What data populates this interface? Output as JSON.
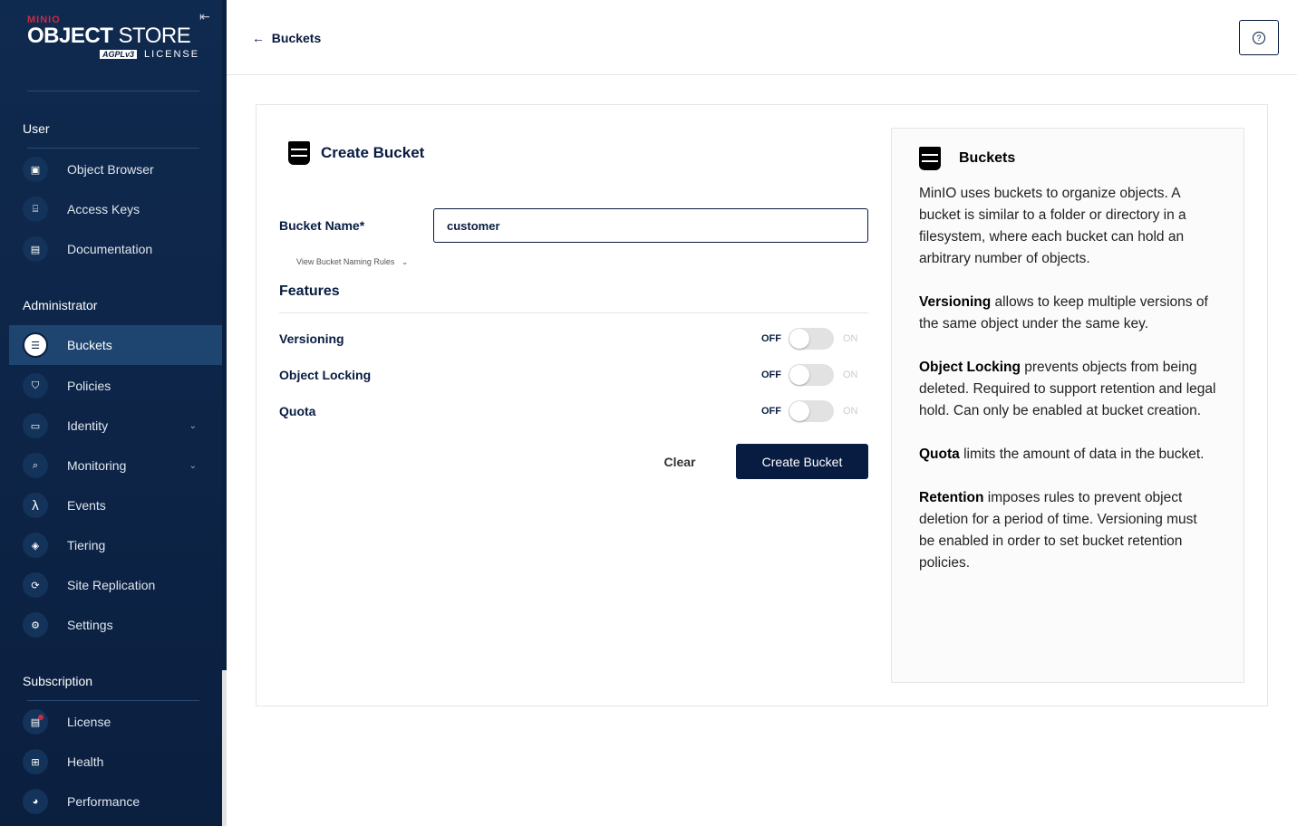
{
  "brand": {
    "minio": "MINIO",
    "object": "OBJECT",
    "store": "STORE",
    "agpl": "AGPLv3",
    "license": "LICENSE"
  },
  "sidebar": {
    "sections": [
      "User",
      "Administrator",
      "Subscription"
    ],
    "user_items": [
      {
        "label": "Object Browser",
        "icon": "object-browser-icon"
      },
      {
        "label": "Access Keys",
        "icon": "key-icon"
      },
      {
        "label": "Documentation",
        "icon": "document-icon"
      }
    ],
    "admin_items": [
      {
        "label": "Buckets",
        "icon": "bucket-icon",
        "active": true
      },
      {
        "label": "Policies",
        "icon": "shield-icon"
      },
      {
        "label": "Identity",
        "icon": "id-card-icon",
        "expandable": true
      },
      {
        "label": "Monitoring",
        "icon": "magnifier-icon",
        "expandable": true
      },
      {
        "label": "Events",
        "icon": "lambda-icon"
      },
      {
        "label": "Tiering",
        "icon": "layers-icon"
      },
      {
        "label": "Site Replication",
        "icon": "sync-icon"
      },
      {
        "label": "Settings",
        "icon": "gear-icon"
      }
    ],
    "sub_items": [
      {
        "label": "License",
        "icon": "license-icon"
      },
      {
        "label": "Health",
        "icon": "health-icon"
      },
      {
        "label": "Performance",
        "icon": "gauge-icon"
      }
    ]
  },
  "header": {
    "back_label": "Buckets",
    "help_icon": "help-icon"
  },
  "form": {
    "title": "Create Bucket",
    "bucket_name_label": "Bucket Name*",
    "bucket_name_value": "customer",
    "naming_rules": "View Bucket Naming Rules",
    "features_title": "Features",
    "features": [
      {
        "label": "Versioning",
        "off": "OFF",
        "on": "ON",
        "enabled": false
      },
      {
        "label": "Object Locking",
        "off": "OFF",
        "on": "ON",
        "enabled": false
      },
      {
        "label": "Quota",
        "off": "OFF",
        "on": "ON",
        "enabled": false
      }
    ],
    "clear_label": "Clear",
    "create_label": "Create Bucket"
  },
  "help_panel": {
    "title": "Buckets",
    "intro": "MinIO uses buckets to organize objects. A bucket is similar to a folder or directory in a filesystem, where each bucket can hold an arbitrary number of objects.",
    "items": [
      {
        "term": "Versioning",
        "text": " allows to keep multiple versions of the same object under the same key."
      },
      {
        "term": "Object Locking",
        "text": " prevents objects from being deleted. Required to support retention and legal hold. Can only be enabled at bucket creation."
      },
      {
        "term": "Quota",
        "text": " limits the amount of data in the bucket."
      },
      {
        "term": "Retention",
        "text": " imposes rules to prevent object deletion for a period of time. Versioning must be enabled in order to set bucket retention policies."
      }
    ]
  },
  "colors": {
    "sidebar": "#0f2a4f",
    "active": "#1e4470",
    "primary": "#081c42",
    "brand_red": "#c72c48"
  }
}
